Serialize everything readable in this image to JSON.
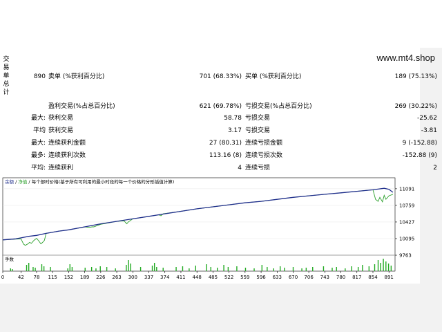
{
  "watermark": "www.mt4.shop",
  "side_label": [
    "交",
    "易",
    "单",
    "总",
    "计"
  ],
  "stats": {
    "total_trades": "890",
    "short_label": "卖单 (%获利百分比)",
    "short_value": "701 (68.33%)",
    "long_label": "买单 (%获利百分比)",
    "long_value": "189 (75.13%)",
    "profit_trades_label": "盈利交易(%占总百分比)",
    "profit_trades_value": "621 (69.78%)",
    "loss_trades_label": "亏损交易(%占总百分比)",
    "loss_trades_value": "269 (30.22%)",
    "largest_prefix": "最大:",
    "largest_profit_label": "获利交易",
    "largest_profit_value": "58.78",
    "largest_loss_label": "亏损交易",
    "largest_loss_value": "-25.62",
    "average_prefix": "平均",
    "average_profit_label": "获利交易",
    "average_profit_value": "3.17",
    "average_loss_label": "亏损交易",
    "average_loss_value": "-3.81",
    "max_prefix": "最大:",
    "max_cons_wins_label": "连续获利金额",
    "max_cons_wins_value": "27 (80.31)",
    "max_cons_losses_label": "连续亏损金额",
    "max_cons_losses_value": "9 (-152.88)",
    "maximal_prefix": "最多:",
    "maximal_cons_profit_label": "连续获利次数",
    "maximal_cons_profit_value": "113.16 (8)",
    "maximal_cons_loss_label": "连续亏损次数",
    "maximal_cons_loss_value": "-152.88 (9)",
    "avg_prefix": "平均:",
    "avg_cons_wins_label": "连续获利",
    "avg_cons_wins_value": "4",
    "avg_cons_losses_label": "连续亏损",
    "avg_cons_losses_value": "2"
  },
  "chart_data": {
    "type": "line",
    "legend_text": "余额 / 净值 / 每个部时价格(基于所有可利用的最小时段的每一个价格的分形插值计算)",
    "legend_balance": "余额",
    "legend_equity": "净值",
    "legend_rest": "每个部时价格(基于所有可利用的最小时段的每一个价格的分形插值计算)",
    "volume_label": "手数",
    "x_ticks": [
      0,
      42,
      78,
      115,
      152,
      189,
      226,
      263,
      300,
      337,
      374,
      411,
      448,
      485,
      522,
      559,
      596,
      633,
      670,
      706,
      743,
      780,
      817,
      854,
      891
    ],
    "y_ticks": [
      11091,
      10759,
      10427,
      10095,
      9763
    ],
    "ylim": [
      9763,
      11200
    ],
    "xlim": [
      0,
      905
    ],
    "colors": {
      "balance": "#1f2e8c",
      "equity": "#2ca02c",
      "volume": "#22aa22"
    },
    "balance": {
      "x": [
        0,
        30,
        42,
        60,
        78,
        100,
        130,
        152,
        189,
        226,
        263,
        300,
        337,
        374,
        411,
        448,
        485,
        522,
        559,
        596,
        633,
        670,
        706,
        743,
        780,
        817,
        854,
        880,
        891,
        900
      ],
      "y": [
        10070,
        10090,
        10110,
        10140,
        10160,
        10200,
        10245,
        10270,
        10330,
        10390,
        10440,
        10490,
        10540,
        10590,
        10640,
        10690,
        10730,
        10770,
        10810,
        10840,
        10880,
        10920,
        10950,
        10980,
        11010,
        11040,
        11070,
        11100,
        11080,
        11020
      ]
    },
    "equity": {
      "x": [
        0,
        42,
        48,
        52,
        58,
        62,
        66,
        72,
        78,
        84,
        88,
        92,
        96,
        100,
        130,
        152,
        189,
        200,
        206,
        210,
        226,
        263,
        280,
        286,
        290,
        300,
        337,
        360,
        365,
        370,
        411,
        448,
        485,
        522,
        559,
        596,
        633,
        670,
        706,
        743,
        780,
        817,
        854,
        860,
        866,
        870,
        876,
        880,
        884,
        891,
        900
      ],
      "y": [
        10070,
        10090,
        9985,
        9960,
        9990,
        10020,
        10000,
        10060,
        10100,
        10040,
        9990,
        10020,
        10060,
        10200,
        10245,
        10270,
        10330,
        10320,
        10330,
        10330,
        10380,
        10440,
        10450,
        10390,
        10430,
        10490,
        10540,
        10570,
        10550,
        10590,
        10640,
        10690,
        10730,
        10770,
        10810,
        10840,
        10880,
        10920,
        10950,
        10980,
        11010,
        11040,
        11070,
        10880,
        10840,
        10920,
        10830,
        10960,
        10880,
        10950,
        10980
      ]
    },
    "volume_x": [
      18,
      22,
      55,
      60,
      70,
      75,
      90,
      95,
      110,
      150,
      155,
      160,
      190,
      205,
      215,
      225,
      240,
      260,
      285,
      290,
      295,
      318,
      345,
      350,
      355,
      370,
      400,
      415,
      430,
      445,
      470,
      480,
      495,
      510,
      520,
      540,
      560,
      580,
      598,
      610,
      625,
      640,
      650,
      670,
      690,
      700,
      715,
      740,
      760,
      770,
      790,
      805,
      820,
      830,
      845,
      858,
      866,
      872,
      878,
      884,
      890,
      896
    ],
    "volume_h": [
      0.2,
      0.15,
      0.45,
      0.6,
      0.3,
      0.25,
      0.5,
      0.35,
      0.3,
      0.2,
      0.5,
      0.3,
      0.25,
      0.3,
      0.2,
      0.35,
      0.3,
      0.2,
      0.45,
      0.8,
      0.55,
      0.3,
      0.4,
      0.6,
      0.3,
      0.25,
      0.3,
      0.35,
      0.2,
      0.4,
      0.5,
      0.3,
      0.25,
      0.45,
      0.3,
      0.35,
      0.25,
      0.2,
      0.45,
      0.3,
      0.2,
      0.35,
      0.25,
      0.3,
      0.2,
      0.25,
      0.3,
      0.35,
      0.25,
      0.3,
      0.2,
      0.35,
      0.3,
      0.45,
      0.35,
      0.5,
      0.8,
      0.6,
      0.9,
      0.7,
      0.55,
      0.4
    ]
  }
}
